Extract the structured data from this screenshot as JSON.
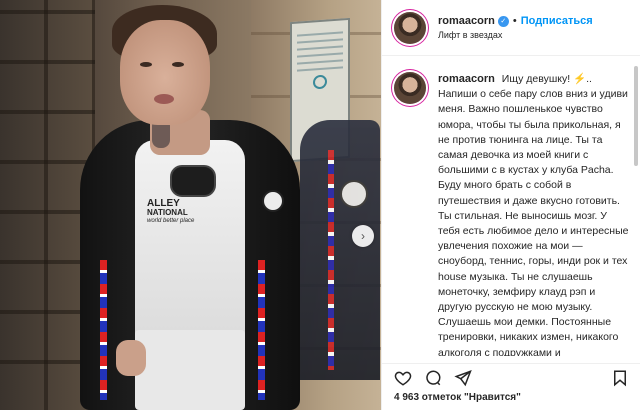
{
  "post": {
    "username": "romaacorn",
    "follow_label": "Подписаться",
    "location": "Лифт в звездах",
    "caption_emoji": "⚡",
    "caption": "Ищу девушку! .. Напиши о себе пару слов вниз и удиви меня. Важно пошленькое чувство юмора, чтобы ты была прикольная, я не против тюнинга на лице. Ты та самая девочка из моей книги с большими с в кустах у клуба Pacha. Буду много брать с собой в путешествия и даже вкусно готовить. Ты стильная. Не выносишь мозг. У тебя есть любимое дело и интересные увлечения похожие на мои — сноуборд, теннис, горы, инди рок и тех house музыка. Ты не слушаешь монеточку, земфиру клауд рэп и другую русскую не мою музыку. Слушаешь мои демки. Постоянные тренировки, никаких измен, никакого алкоголя с подружками и",
    "likes_text": "4 963 отметок \"Нравится\""
  },
  "photo": {
    "tshirt_print_line1": "ALLEY",
    "tshirt_print_line2": "NATIONAL",
    "tshirt_print_sub": "world better place"
  },
  "icons": {
    "like": "heart-icon",
    "comment": "comment-icon",
    "share": "share-icon",
    "save": "bookmark-icon",
    "next": "chevron-right-icon",
    "verified": "verified-badge-icon"
  },
  "colors": {
    "link": "#0095f6",
    "verified": "#3897f0",
    "text": "#262626"
  }
}
